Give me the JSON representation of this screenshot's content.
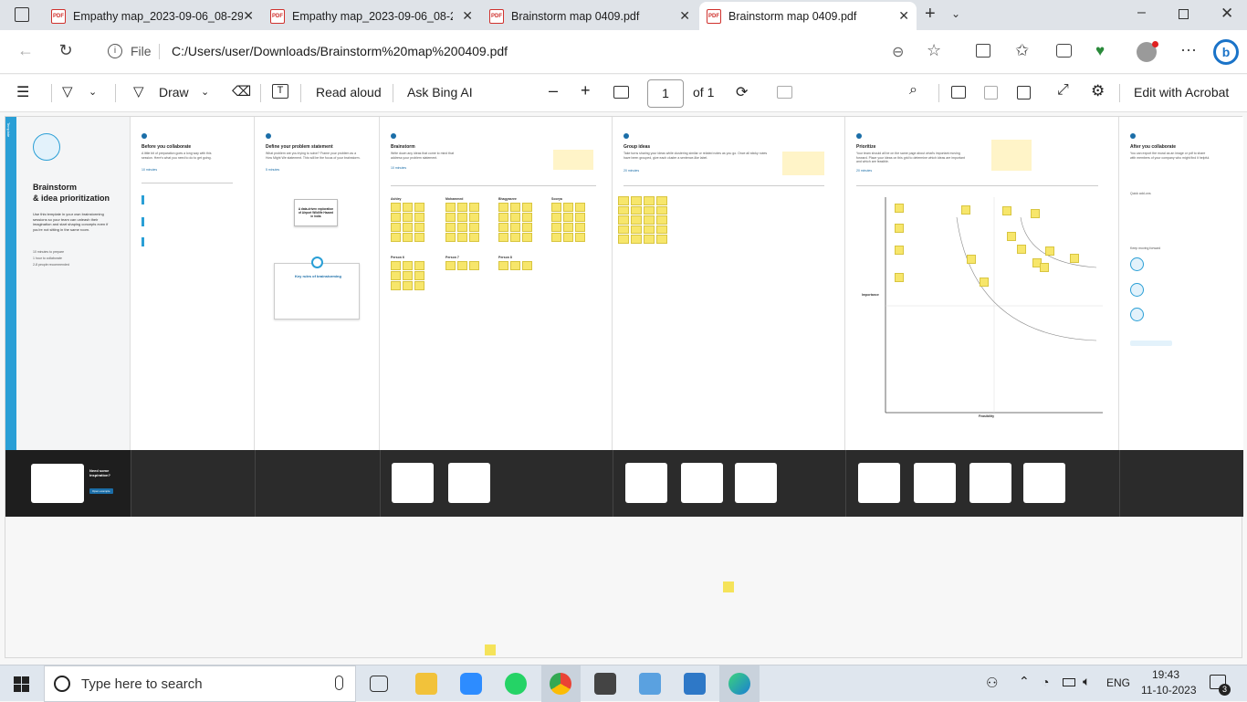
{
  "tabs": [
    {
      "title": "Empathy map_2023-09-06_08-29",
      "active": false
    },
    {
      "title": "Empathy map_2023-09-06_08-29",
      "active": false
    },
    {
      "title": "Brainstorm map 0409.pdf",
      "active": false
    },
    {
      "title": "Brainstorm map 0409.pdf",
      "active": true
    }
  ],
  "address": {
    "prefix": "File",
    "url": "C:/Users/user/Downloads/Brainstorm%20map%200409.pdf"
  },
  "toolbar": {
    "draw": "Draw",
    "read_aloud": "Read aloud",
    "ask_bing": "Ask Bing AI",
    "page": "1",
    "of": "of 1",
    "edit": "Edit with Acrobat"
  },
  "doc": {
    "side_tag": "Template",
    "intro_title1": "Brainstorm",
    "intro_title2": "& idea prioritization",
    "intro_text": "Use this template in your own brainstorming sessions so your team can unleash their imagination and start shaping concepts even if you're not sitting in the same room.",
    "intro_m1": "10 minutes to prepare",
    "intro_m2": "1 hour to collaborate",
    "intro_m3": "2-8 people recommended",
    "p1_title": "Before you collaborate",
    "p1_text": "A little bit of preparation goes a long way with this session. Here's what you need to do to get going.",
    "p1_time": "10 minutes",
    "p2_title": "Define your problem statement",
    "p2_text": "What problem are you trying to solve? Frame your problem as a How Might We statement. This will be the focus of your brainstorm.",
    "p2_time": "5 minutes",
    "p2_card": "A data-driven exploration of Airport Wildlife Hazard in India",
    "p2_rules": "Key rules of brainstorming",
    "p3_title": "Brainstorm",
    "p3_text": "Write down any ideas that come to mind that address your problem statement.",
    "p3_time": "10 minutes",
    "p3_people": [
      "Ashley",
      "Mohammed",
      "Bhagyasree",
      "Soorya",
      "Person 6",
      "Person 7",
      "Person 8"
    ],
    "p4_title": "Group ideas",
    "p4_text": "Take turns sharing your ideas while clustering similar or related notes as you go. Once all sticky notes have been grouped, give each cluster a sentence-like label.",
    "p4_time": "20 minutes",
    "p5_title": "Prioritize",
    "p5_text": "Your team should all be on the same page about what's important moving forward. Place your ideas on this grid to determine which ideas are important and which are feasible.",
    "p5_time": "20 minutes",
    "p5_xlabel": "Feasibility",
    "p5_ylabel": "Importance",
    "p6_title": "After you collaborate",
    "p6_text": "You can export the mural as an image or pdf to share with members of your company who might find it helpful.",
    "p6_quick": "Quick add-ons",
    "p6_keep": "Keep moving forward",
    "dark_text": "Need some inspiration?",
    "dark_btn": "Open example"
  },
  "taskbar": {
    "search_placeholder": "Type here to search",
    "time": "19:43",
    "date": "11-10-2023",
    "lang": "ENG",
    "notif": "3"
  }
}
